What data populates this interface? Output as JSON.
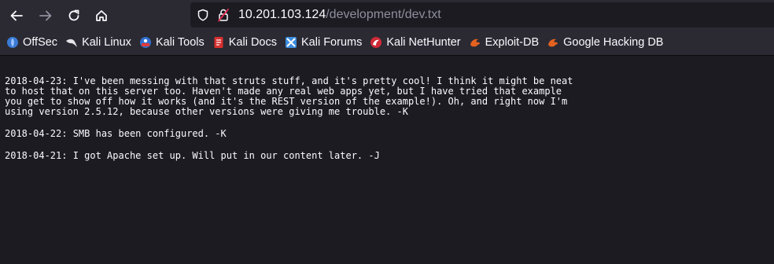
{
  "url": {
    "host": "10.201.103.124",
    "path": "/development/dev.txt"
  },
  "bookmarks": [
    {
      "label": "OffSec",
      "icon": "offsec-icon"
    },
    {
      "label": "Kali Linux",
      "icon": "kali-dragon-icon"
    },
    {
      "label": "Kali Tools",
      "icon": "kali-tools-icon"
    },
    {
      "label": "Kali Docs",
      "icon": "kali-docs-icon"
    },
    {
      "label": "Kali Forums",
      "icon": "kali-forums-icon"
    },
    {
      "label": "Kali NetHunter",
      "icon": "kali-nethunter-icon"
    },
    {
      "label": "Exploit-DB",
      "icon": "exploit-db-icon"
    },
    {
      "label": "Google Hacking DB",
      "icon": "ghdb-icon"
    }
  ],
  "document": {
    "entries": [
      "2018-04-23: I've been messing with that struts stuff, and it's pretty cool! I think it might be neat\nto host that on this server too. Haven't made any real web apps yet, but I have tried that example\nyou get to show off how it works (and it's the REST version of the example!). Oh, and right now I'm\nusing version 2.5.12, because other versions were giving me trouble. -K",
      "2018-04-22: SMB has been configured. -K",
      "2018-04-21: I got Apache set up. Will put in our content later. -J"
    ]
  }
}
